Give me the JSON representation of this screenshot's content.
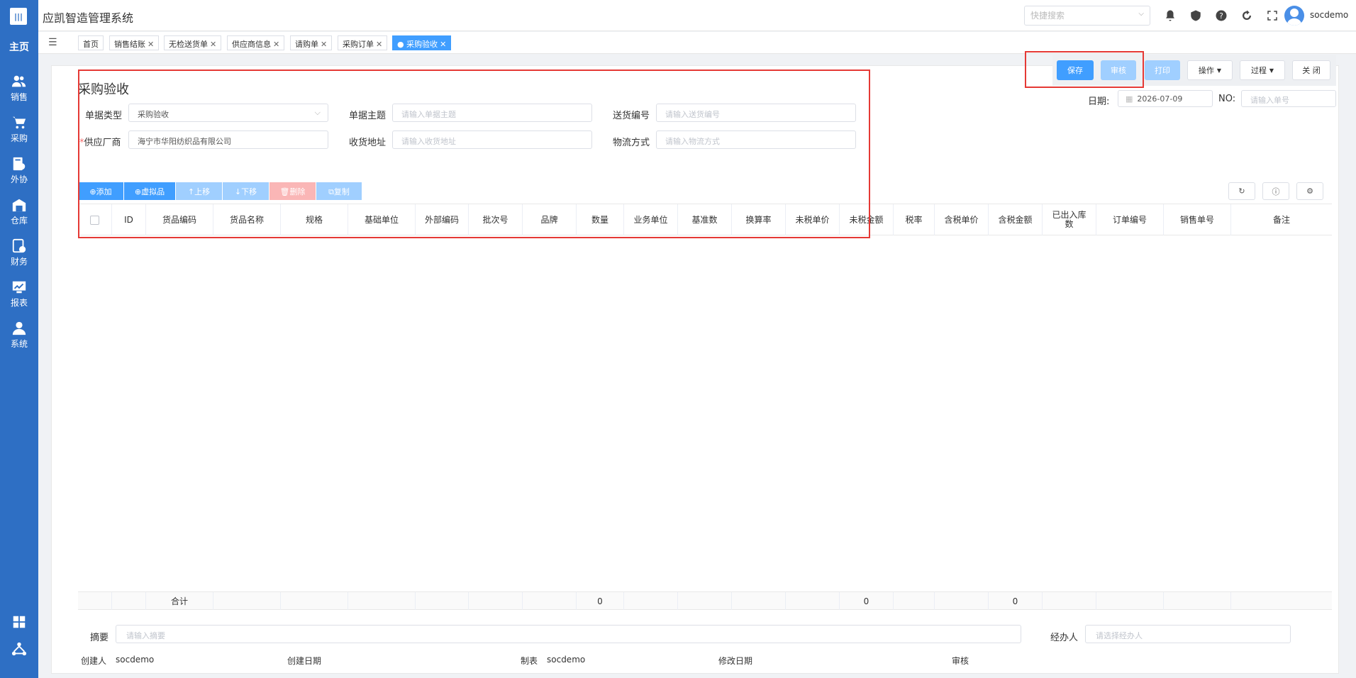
{
  "app": {
    "title": "应凯智造管理系统",
    "user": "socdemo",
    "quick_search_placeholder": "快捷搜索"
  },
  "sidebar": {
    "home": "主页",
    "items": [
      {
        "label": "销售",
        "icon": "people-icon"
      },
      {
        "label": "采购",
        "icon": "cart-icon"
      },
      {
        "label": "外协",
        "icon": "outsource-icon"
      },
      {
        "label": "仓库",
        "icon": "warehouse-icon"
      },
      {
        "label": "财务",
        "icon": "finance-icon"
      },
      {
        "label": "报表",
        "icon": "chart-icon"
      },
      {
        "label": "系统",
        "icon": "user-icon"
      }
    ]
  },
  "tabs": [
    {
      "label": "首页",
      "closable": false
    },
    {
      "label": "销售结账",
      "closable": true
    },
    {
      "label": "无检送货单",
      "closable": true
    },
    {
      "label": "供应商信息",
      "closable": true
    },
    {
      "label": "请购单",
      "closable": true
    },
    {
      "label": "采购订单",
      "closable": true
    },
    {
      "label": "● 采购验收",
      "closable": true,
      "active": true
    }
  ],
  "actions": {
    "save": "保存",
    "audit": "审核",
    "print": "打印",
    "operate": "操作",
    "process": "过程",
    "close": "关 闭"
  },
  "form": {
    "title": "采购验收",
    "date_label": "日期:",
    "date_value": "2026-07-09",
    "no_label": "NO:",
    "no_placeholder": "请输入单号",
    "doc_type_label": "单据类型",
    "doc_type_value": "采购验收",
    "subject_label": "单据主题",
    "subject_placeholder": "请输入单据主题",
    "delivery_no_label": "送货编号",
    "delivery_no_placeholder": "请输入送货编号",
    "supplier_label": "供应厂商",
    "supplier_value": "海宁市华阳纺织品有限公司",
    "address_label": "收货地址",
    "address_placeholder": "请输入收货地址",
    "logistics_label": "物流方式",
    "logistics_placeholder": "请输入物流方式"
  },
  "grid_toolbar": {
    "add": "⊕添加",
    "virtual": "⊕虚拟品",
    "up": "↑上移",
    "down": "↓下移",
    "delete": "🗑删除",
    "copy": "⧉复制"
  },
  "grid": {
    "columns": [
      "ID",
      "货品编码",
      "货品名称",
      "规格",
      "基础单位",
      "外部编码",
      "批次号",
      "品牌",
      "数量",
      "业务单位",
      "基准数",
      "换算率",
      "未税单价",
      "未税金额",
      "税率",
      "含税单价",
      "含税金额",
      "已出入库数",
      "订单编号",
      "销售单号",
      "备注"
    ],
    "footer": {
      "label": "合计",
      "qty": "0",
      "untaxed_amount": "0",
      "taxed_amount": "0"
    }
  },
  "bottom": {
    "summary_label": "摘要",
    "summary_placeholder": "请输入摘要",
    "handler_label": "经办人",
    "handler_placeholder": "请选择经办人",
    "creator_label": "创建人",
    "creator_value": "socdemo",
    "created_date_label": "创建日期",
    "maker_label": "制表",
    "maker_value": "socdemo",
    "modified_date_label": "修改日期",
    "reviewer_label": "审核"
  }
}
